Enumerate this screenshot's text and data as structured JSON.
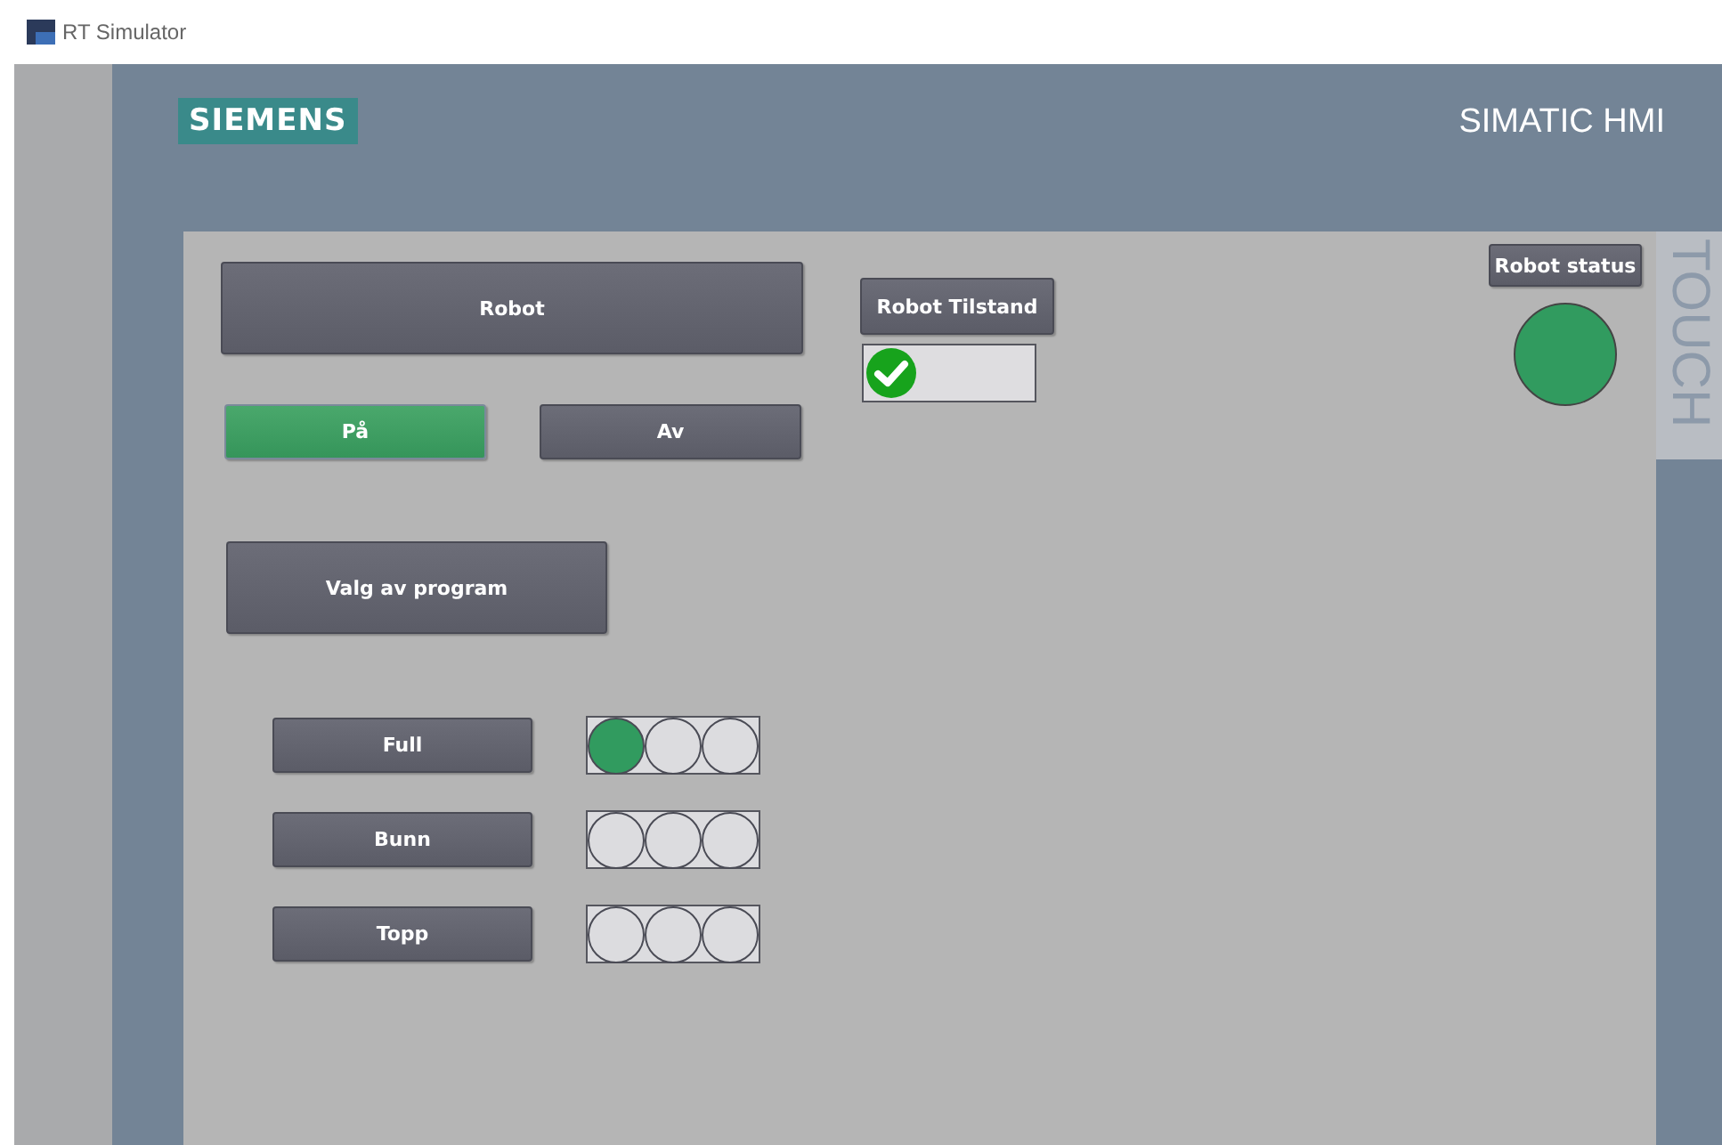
{
  "window": {
    "title": "RT Simulator"
  },
  "header": {
    "logo": "SIEMENS",
    "product": "SIMATIC HMI"
  },
  "side_label": "TOUCH",
  "screen": {
    "robot_button": "Robot",
    "power_buttons": [
      {
        "label": "På",
        "selected": true
      },
      {
        "label": "Av",
        "selected": false
      }
    ],
    "program_button": "Valg av program",
    "programs": [
      {
        "label": "Full",
        "lamps": [
          {
            "on": true
          },
          {
            "on": false
          },
          {
            "on": false
          }
        ]
      },
      {
        "label": "Bunn",
        "lamps": [
          {
            "on": false
          },
          {
            "on": false
          },
          {
            "on": false
          }
        ]
      },
      {
        "label": "Topp",
        "lamps": [
          {
            "on": false
          },
          {
            "on": false
          },
          {
            "on": false
          }
        ]
      }
    ],
    "state_button": "Robot Tilstand",
    "state_ok": true,
    "status_button": "Robot status",
    "status_lamp_on": true
  }
}
